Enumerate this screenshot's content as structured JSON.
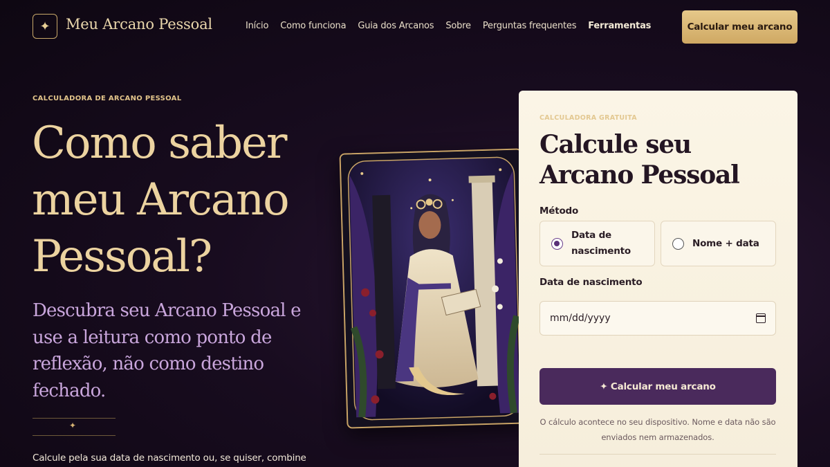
{
  "header": {
    "logo_icon": "sparkle-star-icon",
    "logo_glyph": "✦",
    "brand": "Meu Arcano Pessoal",
    "nav": [
      {
        "label": "Início"
      },
      {
        "label": "Como funciona"
      },
      {
        "label": "Guia dos Arcanos"
      },
      {
        "label": "Sobre"
      },
      {
        "label": "Perguntas frequentes"
      },
      {
        "label": "Ferramentas"
      }
    ],
    "cta": "Calcular meu arcano"
  },
  "hero": {
    "eyebrow": "CALCULADORA DE ARCANO PESSOAL",
    "title": "Como saber meu Arcano Pessoal?",
    "subtitle": "Descubra seu Arcano Pessoal e use a leitura como ponto de reflexão, não como destino fechado.",
    "divider_glyph": "✦",
    "body": "Calcule pela sua data de nascimento ou, se quiser, combine"
  },
  "form": {
    "eyebrow": "CALCULADORA GRATUITA",
    "title": "Calcule seu Arcano Pessoal",
    "method_label": "Método",
    "options": [
      {
        "label": "Data de nascimento",
        "selected": true
      },
      {
        "label": "Nome + data",
        "selected": false
      }
    ],
    "date_label": "Data de nascimento",
    "date_placeholder": "mm/dd/yyyy",
    "submit": "✦ Calcular meu arcano",
    "privacy": "O cálculo acontece no seu dispositivo. Nome e data não são enviados nem armazenados."
  },
  "colors": {
    "background": "#180c1f",
    "gold": "#e6c88a",
    "title_gold": "#ecd3a0",
    "lavender": "#c9a6dc",
    "panel": "#fbf5e6",
    "purple_button": "#4a2a5c"
  }
}
